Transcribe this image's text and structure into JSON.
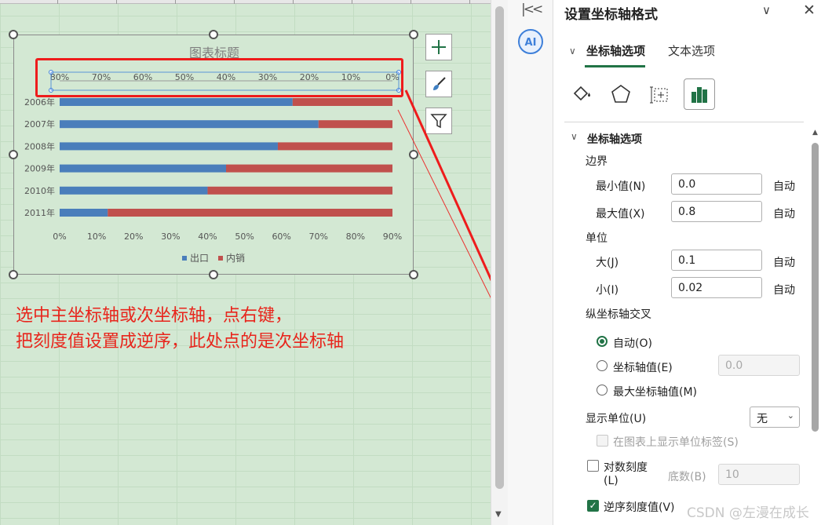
{
  "chart": {
    "title": "图表标题",
    "legend_blue": "出口",
    "legend_red": "内销"
  },
  "chart_data": {
    "type": "bar",
    "orientation": "horizontal",
    "stacked": true,
    "title": "图表标题",
    "categories": [
      "2006年",
      "2007年",
      "2008年",
      "2009年",
      "2010年",
      "2011年"
    ],
    "series": [
      {
        "name": "出口",
        "color": "#4a7ebb",
        "values": [
          0.63,
          0.7,
          0.59,
          0.45,
          0.4,
          0.13
        ]
      },
      {
        "name": "内销",
        "color": "#c0504d",
        "values": [
          0.27,
          0.2,
          0.31,
          0.45,
          0.5,
          0.77
        ]
      }
    ],
    "primary_x_ticks": [
      "0%",
      "10%",
      "20%",
      "30%",
      "40%",
      "50%",
      "60%",
      "70%",
      "80%",
      "90%"
    ],
    "primary_x_range": [
      0,
      0.9
    ],
    "secondary_x_ticks": [
      "80%",
      "70%",
      "60%",
      "50%",
      "40%",
      "30%",
      "20%",
      "10%",
      "0%"
    ],
    "secondary_x_range": [
      0,
      0.8
    ],
    "secondary_x_reversed": true,
    "legend_position": "bottom"
  },
  "annotation": {
    "line1": "选中主坐标轴或次坐标轴，点右键，",
    "line2": "把刻度值设置成逆序，此处点的是次坐标轴"
  },
  "pane": {
    "title": "设置坐标轴格式",
    "tab_axis": "坐标轴选项",
    "tab_text": "文本选项",
    "section": "坐标轴选项",
    "bounds_label": "边界",
    "min_label": "最小值(N)",
    "min_value": "0.0",
    "max_label": "最大值(X)",
    "max_value": "0.8",
    "auto": "自动",
    "units_label": "单位",
    "major_label": "大(J)",
    "major_value": "0.1",
    "minor_label": "小(I)",
    "minor_value": "0.02",
    "cross_label": "纵坐标轴交叉",
    "cross_auto": "自动(O)",
    "cross_value_label": "坐标轴值(E)",
    "cross_value": "0.0",
    "cross_max": "最大坐标轴值(M)",
    "display_units_label": "显示单位(U)",
    "display_units_value": "无",
    "show_units_label": "在图表上显示单位标签(S)",
    "log_scale_label": "对数刻度",
    "log_scale_label2": "(L)",
    "base_label": "底数(B)",
    "base_value": "10",
    "reverse_label": "逆序刻度值(V)"
  },
  "watermark": "CSDN @左漫在成长"
}
